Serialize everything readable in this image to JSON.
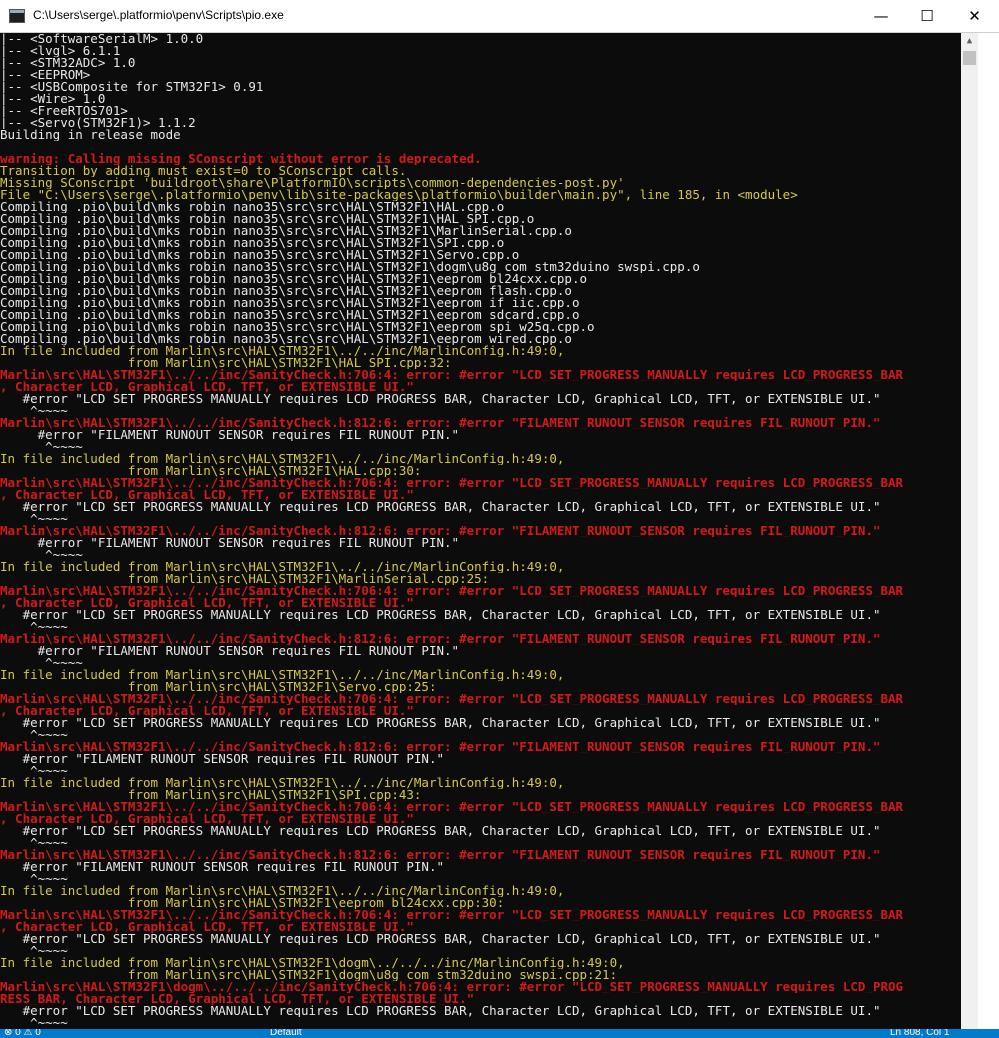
{
  "window": {
    "title": "C:\\Users\\serge\\.platformio\\penv\\Scripts\\pio.exe",
    "minimize": "—",
    "maximize": "☐",
    "close": "✕"
  },
  "console_lines": [
    {
      "t": "|-- <SoftwareSerialM> 1.0.0",
      "c": "w"
    },
    {
      "t": "|-- <lvgl> 6.1.1",
      "c": "w"
    },
    {
      "t": "|-- <STM32ADC> 1.0",
      "c": "w"
    },
    {
      "t": "|-- <EEPROM>",
      "c": "w"
    },
    {
      "t": "|-- <USBComposite for STM32F1> 0.91",
      "c": "w"
    },
    {
      "t": "|-- <Wire> 1.0",
      "c": "w"
    },
    {
      "t": "|-- <FreeRTOS701>",
      "c": "w"
    },
    {
      "t": "|-- <Servo(STM32F1)> 1.1.2",
      "c": "w"
    },
    {
      "t": "Building in release mode",
      "c": "w"
    },
    {
      "t": "",
      "c": "w"
    },
    {
      "t": "warning: Calling missing SConscript without error is deprecated.",
      "c": "r"
    },
    {
      "t": "Transition by adding must_exist=0 to SConscript calls.",
      "c": "y"
    },
    {
      "t": "Missing SConscript 'buildroot\\share\\PlatformIO\\scripts\\common-dependencies-post.py'",
      "c": "y"
    },
    {
      "t": "File \"C:\\Users\\serge\\.platformio\\penv\\lib\\site-packages\\platformio\\builder\\main.py\", line 185, in <module>",
      "c": "y"
    },
    {
      "t": "Compiling .pio\\build\\mks_robin_nano35\\src\\src\\HAL\\STM32F1\\HAL.cpp.o",
      "c": "w"
    },
    {
      "t": "Compiling .pio\\build\\mks_robin_nano35\\src\\src\\HAL\\STM32F1\\HAL_SPI.cpp.o",
      "c": "w"
    },
    {
      "t": "Compiling .pio\\build\\mks_robin_nano35\\src\\src\\HAL\\STM32F1\\MarlinSerial.cpp.o",
      "c": "w"
    },
    {
      "t": "Compiling .pio\\build\\mks_robin_nano35\\src\\src\\HAL\\STM32F1\\SPI.cpp.o",
      "c": "w"
    },
    {
      "t": "Compiling .pio\\build\\mks_robin_nano35\\src\\src\\HAL\\STM32F1\\Servo.cpp.o",
      "c": "w"
    },
    {
      "t": "Compiling .pio\\build\\mks_robin_nano35\\src\\src\\HAL\\STM32F1\\dogm\\u8g_com_stm32duino_swspi.cpp.o",
      "c": "w"
    },
    {
      "t": "Compiling .pio\\build\\mks_robin_nano35\\src\\src\\HAL\\STM32F1\\eeprom_bl24cxx.cpp.o",
      "c": "w"
    },
    {
      "t": "Compiling .pio\\build\\mks_robin_nano35\\src\\src\\HAL\\STM32F1\\eeprom_flash.cpp.o",
      "c": "w"
    },
    {
      "t": "Compiling .pio\\build\\mks_robin_nano35\\src\\src\\HAL\\STM32F1\\eeprom_if_iic.cpp.o",
      "c": "w"
    },
    {
      "t": "Compiling .pio\\build\\mks_robin_nano35\\src\\src\\HAL\\STM32F1\\eeprom_sdcard.cpp.o",
      "c": "w"
    },
    {
      "t": "Compiling .pio\\build\\mks_robin_nano35\\src\\src\\HAL\\STM32F1\\eeprom_spi_w25q.cpp.o",
      "c": "w"
    },
    {
      "t": "Compiling .pio\\build\\mks_robin_nano35\\src\\src\\HAL\\STM32F1\\eeprom_wired.cpp.o",
      "c": "w"
    },
    {
      "t": "In file included from Marlin\\src\\HAL\\STM32F1\\../../inc/MarlinConfig.h:49:0,",
      "c": "y"
    },
    {
      "t": "                 from Marlin\\src\\HAL\\STM32F1\\HAL_SPI.cpp:32:",
      "c": "y"
    },
    {
      "t": "Marlin\\src\\HAL\\STM32F1\\../../inc/SanityCheck.h:706:4: error: #error \"LCD_SET_PROGRESS_MANUALLY requires LCD_PROGRESS_BAR",
      "c": "r"
    },
    {
      "t": ", Character LCD, Graphical LCD, TFT, or EXTENSIBLE_UI.\"",
      "c": "r"
    },
    {
      "t": "   #error \"LCD_SET_PROGRESS_MANUALLY requires LCD_PROGRESS_BAR, Character LCD, Graphical LCD, TFT, or EXTENSIBLE_UI.\"",
      "c": "w"
    },
    {
      "t": "    ^~~~~",
      "c": "w"
    },
    {
      "t": "Marlin\\src\\HAL\\STM32F1\\../../inc/SanityCheck.h:812:6: error: #error \"FILAMENT_RUNOUT_SENSOR requires FIL_RUNOUT_PIN.\"",
      "c": "r"
    },
    {
      "t": "     #error \"FILAMENT_RUNOUT_SENSOR requires FIL_RUNOUT_PIN.\"",
      "c": "w"
    },
    {
      "t": "      ^~~~~",
      "c": "w"
    },
    {
      "t": "In file included from Marlin\\src\\HAL\\STM32F1\\../../inc/MarlinConfig.h:49:0,",
      "c": "y"
    },
    {
      "t": "                 from Marlin\\src\\HAL\\STM32F1\\HAL.cpp:30:",
      "c": "y"
    },
    {
      "t": "Marlin\\src\\HAL\\STM32F1\\../../inc/SanityCheck.h:706:4: error: #error \"LCD_SET_PROGRESS_MANUALLY requires LCD_PROGRESS_BAR",
      "c": "r"
    },
    {
      "t": ", Character LCD, Graphical LCD, TFT, or EXTENSIBLE_UI.\"",
      "c": "r"
    },
    {
      "t": "   #error \"LCD_SET_PROGRESS_MANUALLY requires LCD_PROGRESS_BAR, Character LCD, Graphical LCD, TFT, or EXTENSIBLE_UI.\"",
      "c": "w"
    },
    {
      "t": "    ^~~~~",
      "c": "w"
    },
    {
      "t": "Marlin\\src\\HAL\\STM32F1\\../../inc/SanityCheck.h:812:6: error: #error \"FILAMENT_RUNOUT_SENSOR requires FIL_RUNOUT_PIN.\"",
      "c": "r"
    },
    {
      "t": "     #error \"FILAMENT_RUNOUT_SENSOR requires FIL_RUNOUT_PIN.\"",
      "c": "w"
    },
    {
      "t": "      ^~~~~",
      "c": "w"
    },
    {
      "t": "In file included from Marlin\\src\\HAL\\STM32F1\\../../inc/MarlinConfig.h:49:0,",
      "c": "y"
    },
    {
      "t": "                 from Marlin\\src\\HAL\\STM32F1\\MarlinSerial.cpp:25:",
      "c": "y"
    },
    {
      "t": "Marlin\\src\\HAL\\STM32F1\\../../inc/SanityCheck.h:706:4: error: #error \"LCD_SET_PROGRESS_MANUALLY requires LCD_PROGRESS_BAR",
      "c": "r"
    },
    {
      "t": ", Character LCD, Graphical LCD, TFT, or EXTENSIBLE_UI.\"",
      "c": "r"
    },
    {
      "t": "   #error \"LCD_SET_PROGRESS_MANUALLY requires LCD_PROGRESS_BAR, Character LCD, Graphical LCD, TFT, or EXTENSIBLE_UI.\"",
      "c": "w"
    },
    {
      "t": "    ^~~~~",
      "c": "w"
    },
    {
      "t": "Marlin\\src\\HAL\\STM32F1\\../../inc/SanityCheck.h:812:6: error: #error \"FILAMENT_RUNOUT_SENSOR requires FIL_RUNOUT_PIN.\"",
      "c": "r"
    },
    {
      "t": "     #error \"FILAMENT_RUNOUT_SENSOR requires FIL_RUNOUT_PIN.\"",
      "c": "w"
    },
    {
      "t": "      ^~~~~",
      "c": "w"
    },
    {
      "t": "In file included from Marlin\\src\\HAL\\STM32F1\\../../inc/MarlinConfig.h:49:0,",
      "c": "y"
    },
    {
      "t": "                 from Marlin\\src\\HAL\\STM32F1\\Servo.cpp:25:",
      "c": "y"
    },
    {
      "t": "Marlin\\src\\HAL\\STM32F1\\../../inc/SanityCheck.h:706:4: error: #error \"LCD_SET_PROGRESS_MANUALLY requires LCD_PROGRESS_BAR",
      "c": "r"
    },
    {
      "t": ", Character LCD, Graphical LCD, TFT, or EXTENSIBLE_UI.\"",
      "c": "r"
    },
    {
      "t": "   #error \"LCD_SET_PROGRESS_MANUALLY requires LCD_PROGRESS_BAR, Character LCD, Graphical LCD, TFT, or EXTENSIBLE_UI.\"",
      "c": "w"
    },
    {
      "t": "    ^~~~~",
      "c": "w"
    },
    {
      "t": "Marlin\\src\\HAL\\STM32F1\\../../inc/SanityCheck.h:812:6: error: #error \"FILAMENT_RUNOUT_SENSOR requires FIL_RUNOUT_PIN.\"",
      "c": "r"
    },
    {
      "t": "   #error \"FILAMENT_RUNOUT_SENSOR requires FIL_RUNOUT_PIN.\"",
      "c": "w"
    },
    {
      "t": "    ^~~~~",
      "c": "w"
    },
    {
      "t": "In file included from Marlin\\src\\HAL\\STM32F1\\../../inc/MarlinConfig.h:49:0,",
      "c": "y"
    },
    {
      "t": "                 from Marlin\\src\\HAL\\STM32F1\\SPI.cpp:43:",
      "c": "y"
    },
    {
      "t": "Marlin\\src\\HAL\\STM32F1\\../../inc/SanityCheck.h:706:4: error: #error \"LCD_SET_PROGRESS_MANUALLY requires LCD_PROGRESS_BAR",
      "c": "r"
    },
    {
      "t": ", Character LCD, Graphical LCD, TFT, or EXTENSIBLE_UI.\"",
      "c": "r"
    },
    {
      "t": "   #error \"LCD_SET_PROGRESS_MANUALLY requires LCD_PROGRESS_BAR, Character LCD, Graphical LCD, TFT, or EXTENSIBLE_UI.\"",
      "c": "w"
    },
    {
      "t": "    ^~~~~",
      "c": "w"
    },
    {
      "t": "Marlin\\src\\HAL\\STM32F1\\../../inc/SanityCheck.h:812:6: error: #error \"FILAMENT_RUNOUT_SENSOR requires FIL_RUNOUT_PIN.\"",
      "c": "r"
    },
    {
      "t": "   #error \"FILAMENT_RUNOUT_SENSOR requires FIL_RUNOUT_PIN.\"",
      "c": "w"
    },
    {
      "t": "    ^~~~~",
      "c": "w"
    },
    {
      "t": "In file included from Marlin\\src\\HAL\\STM32F1\\../../inc/MarlinConfig.h:49:0,",
      "c": "y"
    },
    {
      "t": "                 from Marlin\\src\\HAL\\STM32F1\\eeprom_bl24cxx.cpp:30:",
      "c": "y"
    },
    {
      "t": "Marlin\\src\\HAL\\STM32F1\\../../inc/SanityCheck.h:706:4: error: #error \"LCD_SET_PROGRESS_MANUALLY requires LCD_PROGRESS_BAR",
      "c": "r"
    },
    {
      "t": ", Character LCD, Graphical LCD, TFT, or EXTENSIBLE_UI.\"",
      "c": "r"
    },
    {
      "t": "   #error \"LCD_SET_PROGRESS_MANUALLY requires LCD_PROGRESS_BAR, Character LCD, Graphical LCD, TFT, or EXTENSIBLE_UI.\"",
      "c": "w"
    },
    {
      "t": "    ^~~~~",
      "c": "w"
    },
    {
      "t": "In file included from Marlin\\src\\HAL\\STM32F1\\dogm\\../../../inc/MarlinConfig.h:49:0,",
      "c": "y"
    },
    {
      "t": "                 from Marlin\\src\\HAL\\STM32F1\\dogm\\u8g_com_stm32duino_swspi.cpp:21:",
      "c": "y"
    },
    {
      "t": "Marlin\\src\\HAL\\STM32F1\\dogm\\../../../inc/SanityCheck.h:706:4: error: #error \"LCD_SET_PROGRESS_MANUALLY requires LCD_PROG",
      "c": "r"
    },
    {
      "t": "RESS_BAR, Character LCD, Graphical LCD, TFT, or EXTENSIBLE_UI.\"",
      "c": "r"
    },
    {
      "t": "   #error \"LCD_SET_PROGRESS_MANUALLY requires LCD_PROGRESS_BAR, Character LCD, Graphical LCD, TFT, or EXTENSIBLE_UI.\"",
      "c": "w"
    },
    {
      "t": "    ^~~~~",
      "c": "w"
    }
  ],
  "statusbar": {
    "left": "⊗ 0  ⚠ 0",
    "profile": "Default",
    "position": "Ln 808, Col 1"
  },
  "colors": {
    "white": "#e8e8e8",
    "red": "#d31a1a",
    "yellow": "#d6c84a",
    "status": "#007acc"
  }
}
